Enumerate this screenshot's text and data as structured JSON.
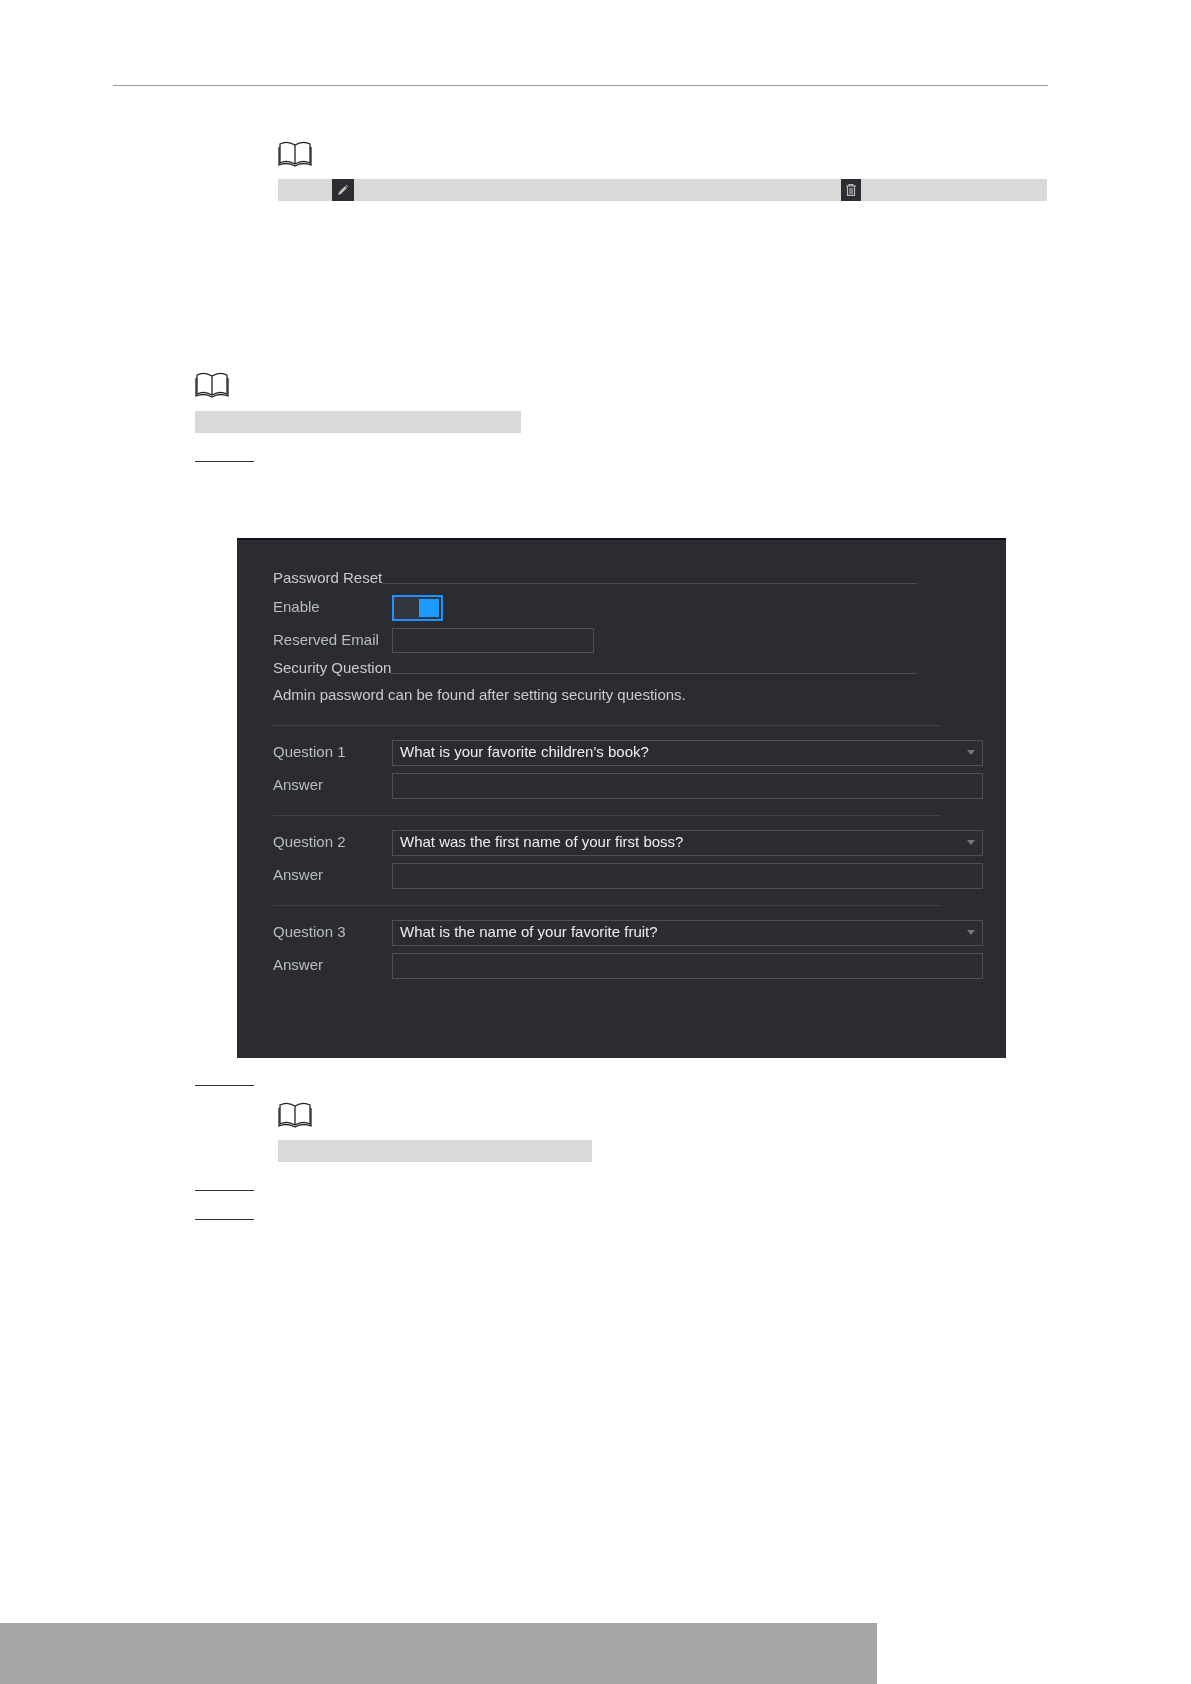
{
  "panel": {
    "password_reset_title": "Password Reset",
    "enable": {
      "label": "Enable",
      "on": true
    },
    "reserved_email": {
      "label": "Reserved Email"
    },
    "security_title": "Security Question",
    "hint": "Admin password can be found after setting security questions.",
    "questions": [
      {
        "label": "Question 1",
        "value": "What is your favorite children's book?",
        "answer_label": "Answer"
      },
      {
        "label": "Question 2",
        "value": "What was the first name of your first boss?",
        "answer_label": "Answer"
      },
      {
        "label": "Question 3",
        "value": "What is the name of your favorite fruit?",
        "answer_label": "Answer"
      }
    ]
  }
}
